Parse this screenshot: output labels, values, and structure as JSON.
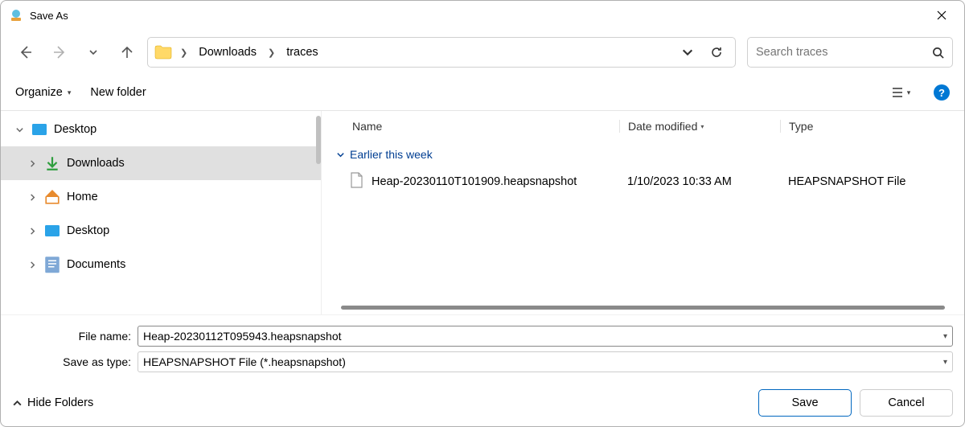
{
  "title": "Save As",
  "breadcrumbs": {
    "p0": "Downloads",
    "p1": "traces"
  },
  "search": {
    "placeholder": "Search traces"
  },
  "cmd": {
    "organize": "Organize",
    "new_folder": "New folder"
  },
  "sidebar": {
    "root": "Desktop",
    "items": {
      "downloads": "Downloads",
      "home": "Home",
      "desktop": "Desktop",
      "documents": "Documents"
    }
  },
  "columns": {
    "name": "Name",
    "date": "Date modified",
    "type": "Type"
  },
  "group": {
    "earlier_week": "Earlier this week"
  },
  "files": {
    "f0": {
      "name": "Heap-20230110T101909.heapsnapshot",
      "date": "1/10/2023 10:33 AM",
      "type": "HEAPSNAPSHOT File"
    }
  },
  "form": {
    "file_name_label": "File name:",
    "file_name_value": "Heap-20230112T095943.heapsnapshot",
    "save_type_label": "Save as type:",
    "save_type_value": "HEAPSNAPSHOT File (*.heapsnapshot)"
  },
  "footer": {
    "hide_folders": "Hide Folders",
    "save": "Save",
    "cancel": "Cancel"
  }
}
